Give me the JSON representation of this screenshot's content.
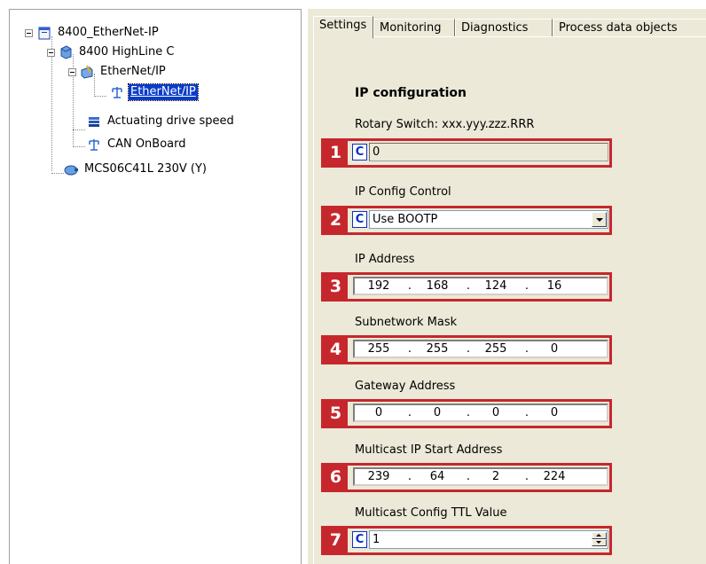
{
  "tree": {
    "items": [
      {
        "label": "8400_EtherNet-IP"
      },
      {
        "label": "8400 HighLine C"
      },
      {
        "label": "EtherNet/IP"
      },
      {
        "label": "EtherNet/IP"
      },
      {
        "label": "Actuating drive speed"
      },
      {
        "label": "CAN OnBoard"
      },
      {
        "label": "MCS06C41L 230V (Y)"
      }
    ]
  },
  "tabs": [
    {
      "label": "Settings"
    },
    {
      "label": "Monitoring"
    },
    {
      "label": "Diagnostics"
    },
    {
      "label": "Process data objects"
    }
  ],
  "settings": {
    "section_title": "IP configuration",
    "c_label": "C",
    "dot": ".",
    "fields": [
      {
        "number": "1",
        "label": "Rotary Switch: xxx.yyy.zzz.RRR",
        "value": "0"
      },
      {
        "number": "2",
        "label": "IP Config Control",
        "value": "Use BOOTP"
      },
      {
        "number": "3",
        "label": "IP Address",
        "octets": [
          "192",
          "168",
          "124",
          "16"
        ]
      },
      {
        "number": "4",
        "label": "Subnetwork Mask",
        "octets": [
          "255",
          "255",
          "255",
          "0"
        ]
      },
      {
        "number": "5",
        "label": "Gateway Address",
        "octets": [
          "0",
          "0",
          "0",
          "0"
        ]
      },
      {
        "number": "6",
        "label": "Multicast IP Start Address",
        "octets": [
          "239",
          "64",
          "2",
          "224"
        ]
      },
      {
        "number": "7",
        "label": "Multicast Config TTL Value",
        "value": "1"
      }
    ]
  },
  "colors": {
    "callout": "#c6272d",
    "selection": "#0a3cc8",
    "panel": "#ece9d8"
  }
}
